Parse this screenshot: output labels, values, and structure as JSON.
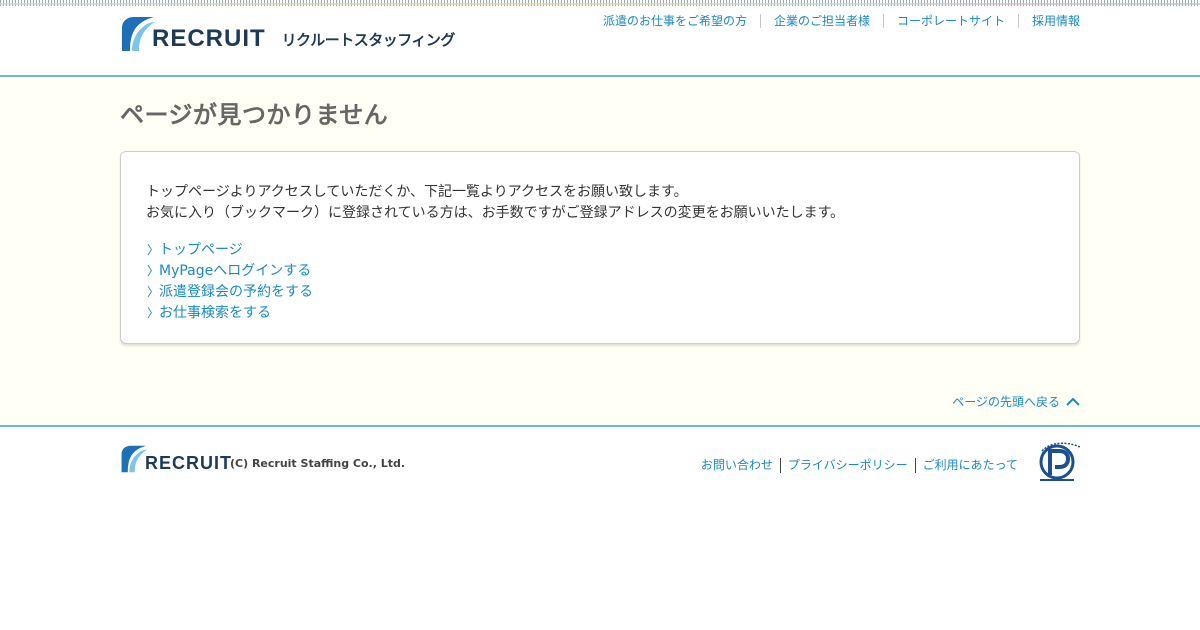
{
  "header": {
    "logo_text": "RECRUIT",
    "logo_sub": "リクルートスタッフィング",
    "nav": [
      "派遣のお仕事をご希望の方",
      "企業のご担当者様",
      "コーポレートサイト",
      "採用情報"
    ]
  },
  "main": {
    "title": "ページが見つかりません",
    "message_lines": [
      "トップページよりアクセスしていただくか、下記一覧よりアクセスをお願い致します。",
      "お気に入り（ブックマーク）に登録されている方は、お手数ですがご登録アドレスの変更をお願いいたします。"
    ],
    "links": [
      "トップページ",
      "MyPageへログインする",
      "派遣登録会の予約をする",
      "お仕事検索をする"
    ],
    "back_to_top": "ページの先頭へ戻る"
  },
  "footer": {
    "logo_text": "RECRUIT",
    "copyright": "(C) Recruit Staffing Co., Ltd.",
    "nav": [
      "お問い合わせ",
      "プライバシーポリシー",
      "ご利用にあたって"
    ]
  },
  "colors": {
    "accent": "#1a88c9",
    "border_blue": "#6fb6de",
    "main_bg": "#fffff6",
    "logo_navy": "#1d3a58"
  },
  "icons": {
    "logo_mark": "recruit-logo-icon",
    "link_bullet": "chevron-right-icon",
    "back_top": "chevron-up-icon",
    "privacy": "privacy-mark-icon"
  }
}
